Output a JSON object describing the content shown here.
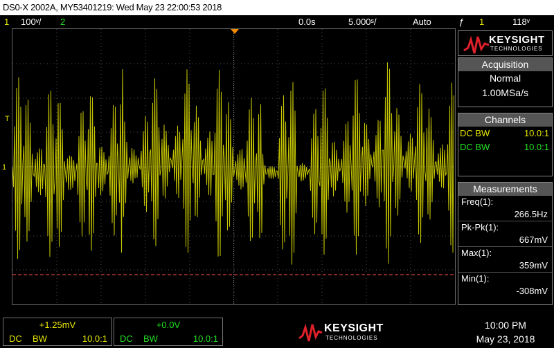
{
  "title_bar": {
    "text": "DS0-X 2002A, MY53401219: Wed May 23 22:00:53 2018"
  },
  "status": {
    "ch1_num": "1",
    "ch1_scale": "100ᵛ/",
    "ch2_num": "2",
    "time_delay": "0.0s",
    "time_scale": "5.000ˢ/",
    "run_mode": "Auto",
    "trigger_icon": "ƒ",
    "trigger_source": "1",
    "trigger_level": "118ᵛ"
  },
  "side_labels": {
    "trigger": "T",
    "ground": "1"
  },
  "logo": {
    "brand": "KEYSIGHT",
    "sub": "TECHNOLOGIES"
  },
  "acquisition": {
    "heading": "Acquisition",
    "mode": "Normal",
    "rate": "1.00MSa/s"
  },
  "channels": {
    "heading": "Channels",
    "items": [
      {
        "coupling": "DC BW",
        "probe": "10.0:1",
        "color": "#e8e800"
      },
      {
        "coupling": "DC BW",
        "probe": "10.0:1",
        "color": "#22e022"
      }
    ]
  },
  "measurements": {
    "heading": "Measurements",
    "items": [
      {
        "name": "Freq(1):",
        "value": "266.5Hz"
      },
      {
        "name": "Pk-Pk(1):",
        "value": "667mV"
      },
      {
        "name": "Max(1):",
        "value": "359mV"
      },
      {
        "name": "Min(1):",
        "value": "-308mV"
      }
    ]
  },
  "bottom": {
    "ch1": {
      "offset": "+1.25mV",
      "dc": "DC",
      "bw": "BW",
      "probe": "10.0:1"
    },
    "ch2": {
      "offset": "+0.0V",
      "dc": "DC",
      "bw": "BW",
      "probe": "10.0:1"
    }
  },
  "clock": {
    "time": "10:00 PM",
    "date": "May 23, 2018"
  },
  "colors": {
    "ch1": "#e8e800",
    "ch2": "#22e022",
    "trigger": "#f08a00",
    "ref_line": "#ff5050"
  }
}
